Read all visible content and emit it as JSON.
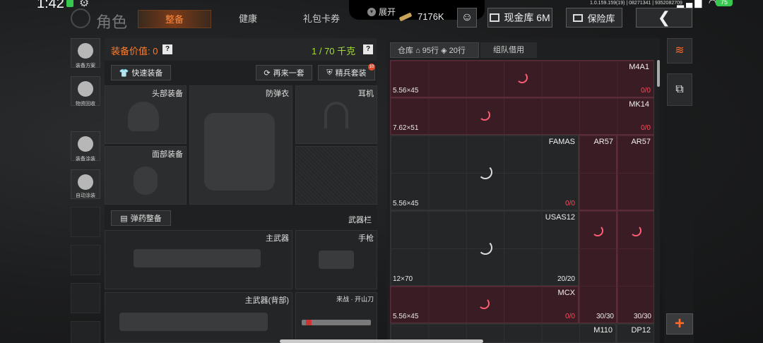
{
  "status": {
    "time": "1:42",
    "net_info": "1.0.159.159(19) | 08271341 | 9352082709",
    "battery": "75"
  },
  "notch": {
    "expand_label": "展开"
  },
  "header": {
    "title": "角色",
    "tabs": [
      {
        "label": "整备",
        "active": true
      },
      {
        "label": "健康"
      },
      {
        "label": "礼包卡券"
      }
    ],
    "money": "7176K",
    "cash_label": "现金库 6M",
    "safe_label": "保险库"
  },
  "sidebar": {
    "items": [
      {
        "label": "装备方案",
        "icon": "helmet-icon"
      },
      {
        "label": "物资回收",
        "icon": "recycle-icon"
      },
      {
        "label": "装备涂装",
        "icon": "paint-icon"
      },
      {
        "label": "自动涂装",
        "icon": "auto-paint-icon"
      }
    ]
  },
  "equipment": {
    "value_label": "装备价值: 0",
    "weight": "1 / 70 千克",
    "quick_equip": "快速装备",
    "again": "再来一套",
    "elite_set": "精兵套装",
    "elite_badge": "10",
    "slots": {
      "head": "头部装备",
      "armor": "防弹衣",
      "ear": "耳机",
      "face": "面部装备",
      "ammo": "弹药整备",
      "weapon_bar": "武器栏",
      "primary": "主武器",
      "pistol": "手枪",
      "primary_back": "主武器(背部)",
      "melee": "来战 · 开山刀"
    }
  },
  "warehouse": {
    "tab_label": "仓库",
    "rows_1": "95行",
    "rows_2": "20行",
    "team_tab": "组队借用",
    "items": {
      "m4a1": {
        "name": "M4A1",
        "cal": "5.56×45",
        "ammo": "0/0"
      },
      "mk14": {
        "name": "MK14",
        "cal": "7.62×51",
        "ammo": "0/0"
      },
      "famas": {
        "name": "FAMAS",
        "cal": "5.56×45",
        "ammo": "0/0"
      },
      "ar57a": {
        "name": "AR57"
      },
      "ar57b": {
        "name": "AR57"
      },
      "usas12": {
        "name": "USAS12",
        "cal": "12×70",
        "ammo": "20/20"
      },
      "mcx": {
        "name": "MCX",
        "cal": "5.56×45",
        "ammo": "0/0"
      },
      "mcx_mid": {
        "ammo": "30/30"
      },
      "mcx_right": {
        "ammo": "30/30"
      },
      "m110": {
        "name": "M110"
      },
      "dp12": {
        "name": "DP12"
      }
    }
  },
  "colors": {
    "accent": "#ff7b2c",
    "weight_green": "#a6dc3a",
    "red_cell": "#3a1c24",
    "ammo_red": "#ff4a5a"
  }
}
